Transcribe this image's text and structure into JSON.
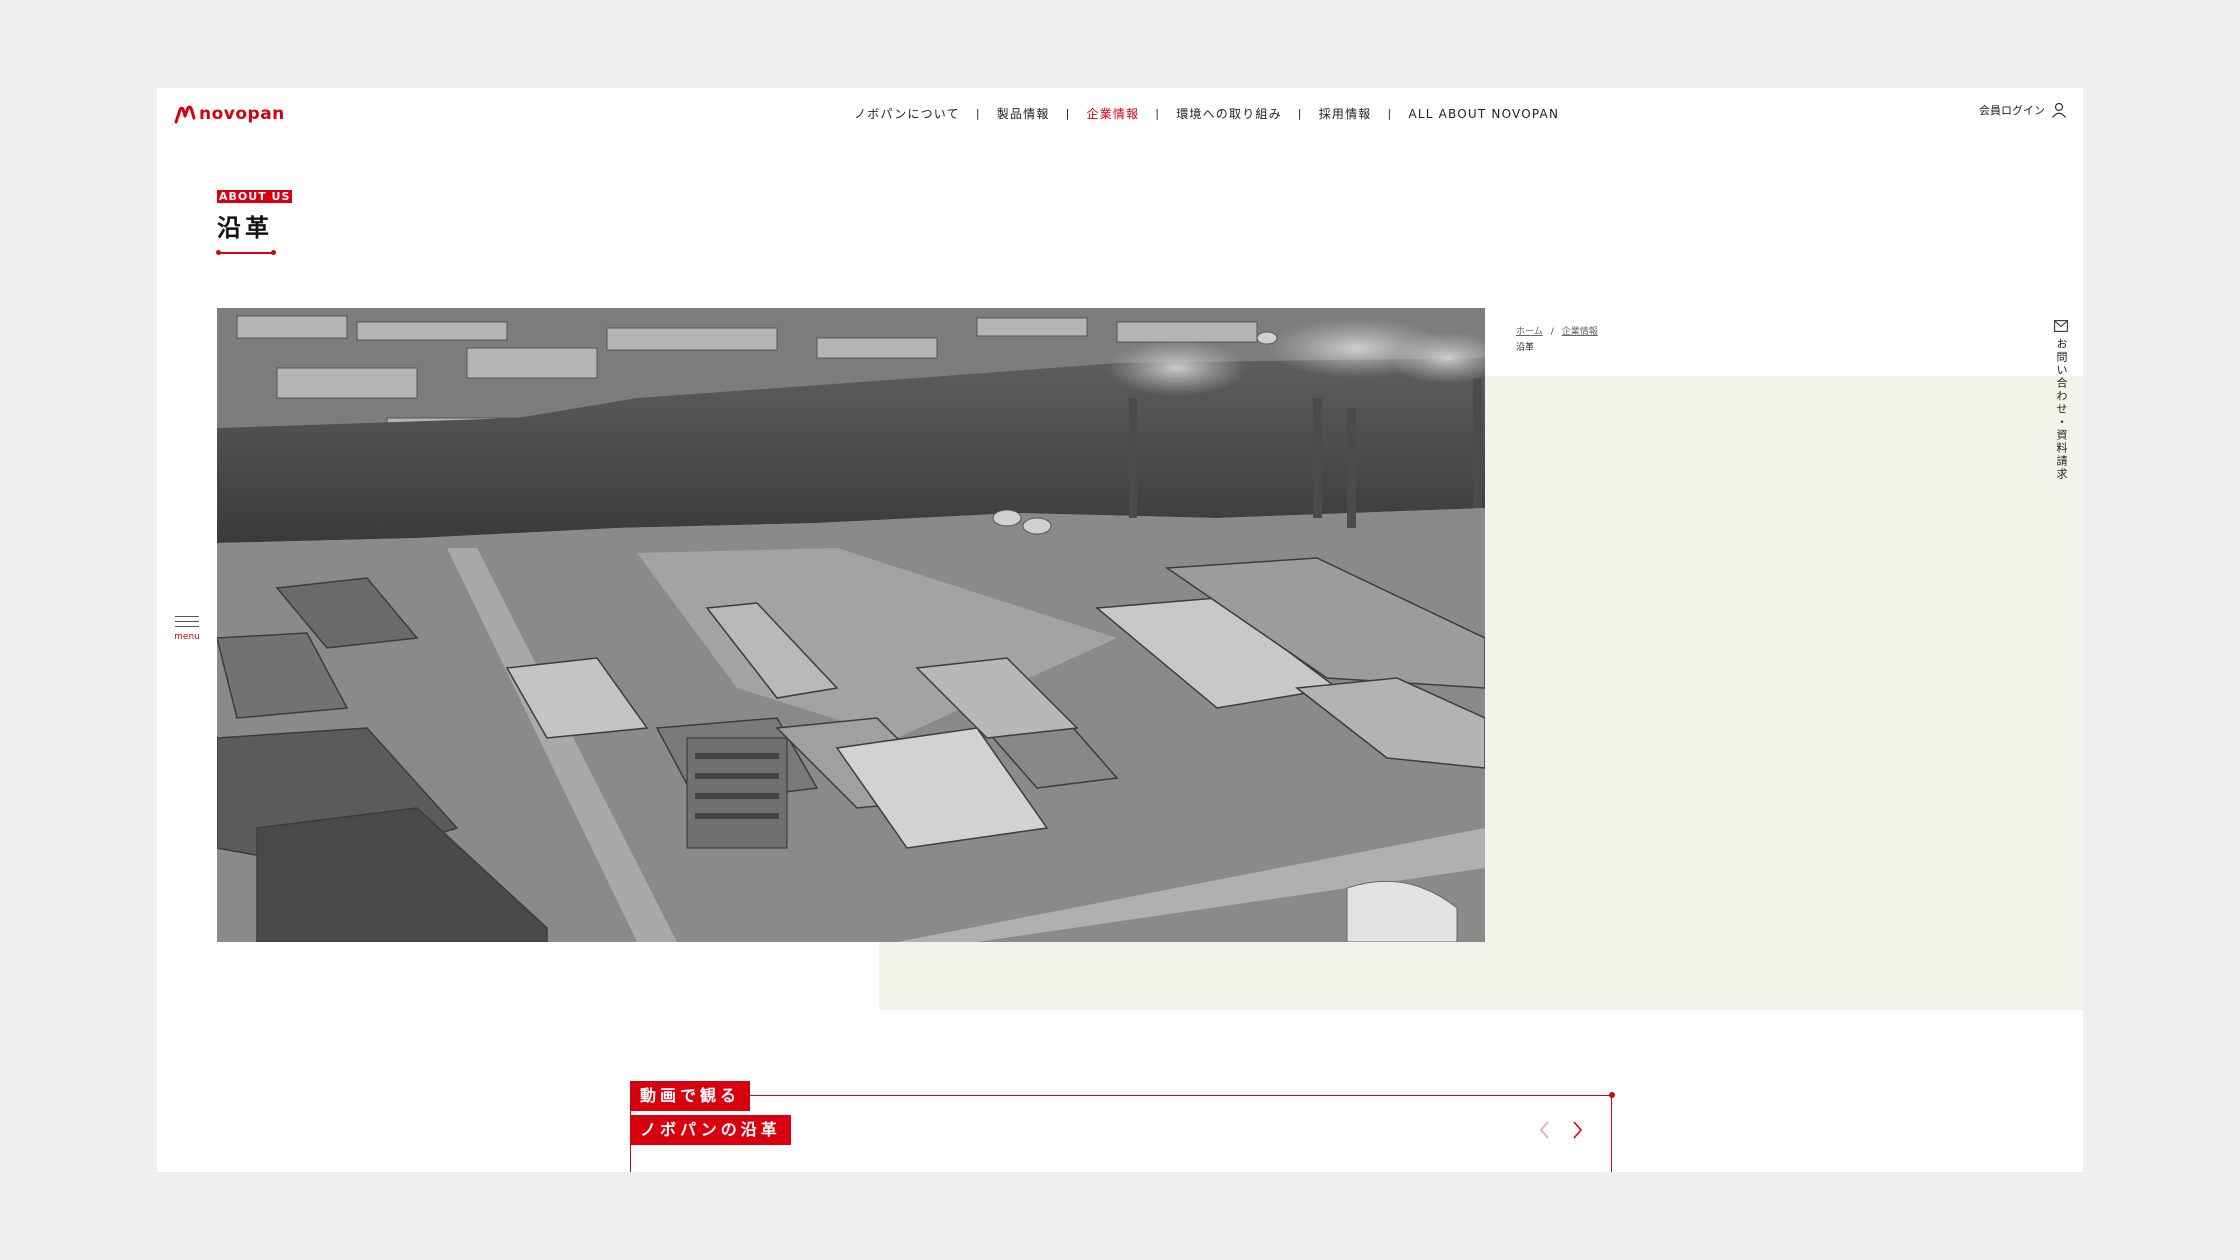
{
  "brand": {
    "name": "novopan",
    "color": "#d7000f"
  },
  "nav": {
    "items": [
      {
        "label": "ノボパンについて",
        "active": false
      },
      {
        "label": "製品情報",
        "active": false
      },
      {
        "label": "企業情報",
        "active": true
      },
      {
        "label": "環境への取り組み",
        "active": false
      },
      {
        "label": "採用情報",
        "active": false
      },
      {
        "label": "ALL ABOUT NOVOPAN",
        "active": false
      }
    ],
    "separator": "|",
    "login_label": "会員ログイン",
    "login_icon": "user-icon"
  },
  "title": {
    "eyebrow": "ABOUT US",
    "main": "沿革"
  },
  "hero": {
    "image": "black-and-white aerial photo of factory complex on a river"
  },
  "breadcrumb": {
    "items": [
      "ホーム",
      "企業情報"
    ],
    "separator": "/",
    "current": "沿革"
  },
  "side_contact": {
    "label": "お問い合わせ・資料請求",
    "icon": "mail-icon"
  },
  "menu": {
    "label": "menu",
    "icon": "hamburger-icon"
  },
  "video": {
    "tag_line1": "動画で観る",
    "tag_line2": "ノボパンの沿革",
    "prev_icon": "chevron-left-icon",
    "next_icon": "chevron-right-icon"
  },
  "colors": {
    "accent": "#d7000f",
    "beige": "#f3f2eb",
    "background": "#efefef"
  }
}
